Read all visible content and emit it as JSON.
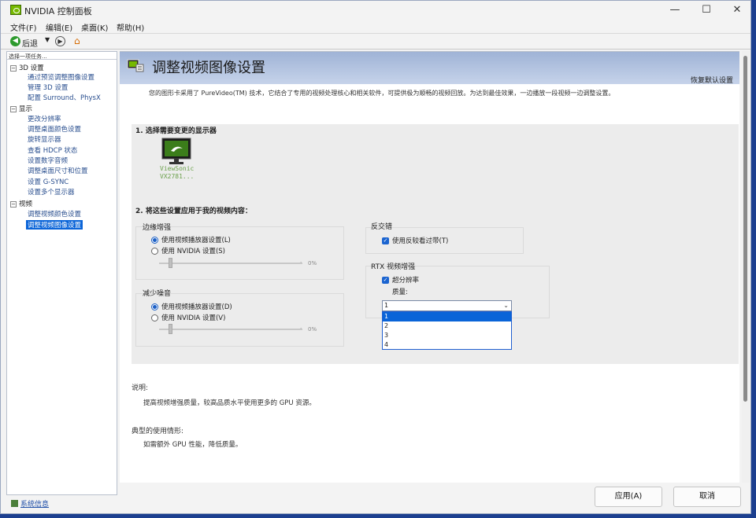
{
  "window": {
    "title": "NVIDIA 控制面板",
    "controls": {
      "minimize": "—",
      "maximize": "☐",
      "close": "✕"
    }
  },
  "menu": [
    "文件(F)",
    "编辑(E)",
    "桌面(K)",
    "帮助(H)"
  ],
  "toolbar": {
    "back_label": "后退",
    "back_icon": "back-arrow-icon",
    "forward_icon": "forward-arrow-icon",
    "home_icon": "home-icon"
  },
  "tree": {
    "caption": "选择一项任务...",
    "nodes": [
      {
        "label": "3D 设置",
        "items": [
          "通过预览调整图像设置",
          "管理 3D 设置",
          "配置 Surround、PhysX"
        ]
      },
      {
        "label": "显示",
        "items": [
          "更改分辨率",
          "调整桌面颜色设置",
          "旋转显示器",
          "查看 HDCP 状态",
          "设置数字音频",
          "调整桌面尺寸和位置",
          "设置 G-SYNC",
          "设置多个显示器"
        ]
      },
      {
        "label": "视频",
        "items": [
          "调整视频颜色设置",
          "调整视频图像设置"
        ]
      }
    ],
    "selected": "调整视频图像设置"
  },
  "system_info": "系统信息",
  "page": {
    "title": "调整视频图像设置",
    "restore_defaults": "恢复默认设置",
    "description": "您的图形卡采用了 PureVideo(TM) 技术，它结合了专用的视频处理核心和相关软件，可提供极为顺畅的视频回放。为达到最佳效果，一边播放一段视频一边调整设置。",
    "step1": "1. 选择需要变更的显示器",
    "monitor": {
      "line1": "ViewSonic",
      "line2": "VX2781..."
    },
    "step2": "2. 将这些设置应用于我的视频内容：",
    "edge": {
      "title": "边缘增强",
      "opt1": "使用视频播放器设置(L)",
      "opt2": "使用 NVIDIA 设置(S)",
      "selected": 1,
      "slider_value": "0%"
    },
    "noise": {
      "title": "减少噪音",
      "opt1": "使用视频播放器设置(D)",
      "opt2": "使用 NVIDIA 设置(V)",
      "selected": 1,
      "slider_value": "0%"
    },
    "deinterlace": {
      "title": "反交错",
      "check_label": "使用反较看过带(T)",
      "checked": true
    },
    "rtx": {
      "title": "RTX 视频增强",
      "check_label": "超分辨率",
      "checked": true,
      "quality_label": "质量:",
      "quality_value": "1",
      "options": [
        "1",
        "2",
        "3",
        "4"
      ],
      "highlighted_option": "1"
    },
    "explanation_label": "说明:",
    "explanation_text": "提高视频增强质量，较高品质水平使用更多的 GPU 资源。",
    "usage_label": "典型的使用情形:",
    "usage_text": "如需额外 GPU 性能，降低质量。"
  },
  "buttons": {
    "apply": "应用(A)",
    "cancel": "取消"
  },
  "colors": {
    "accent": "#0a64d8",
    "nvidia_green": "#76b900",
    "banner": "#b4c4e2"
  }
}
